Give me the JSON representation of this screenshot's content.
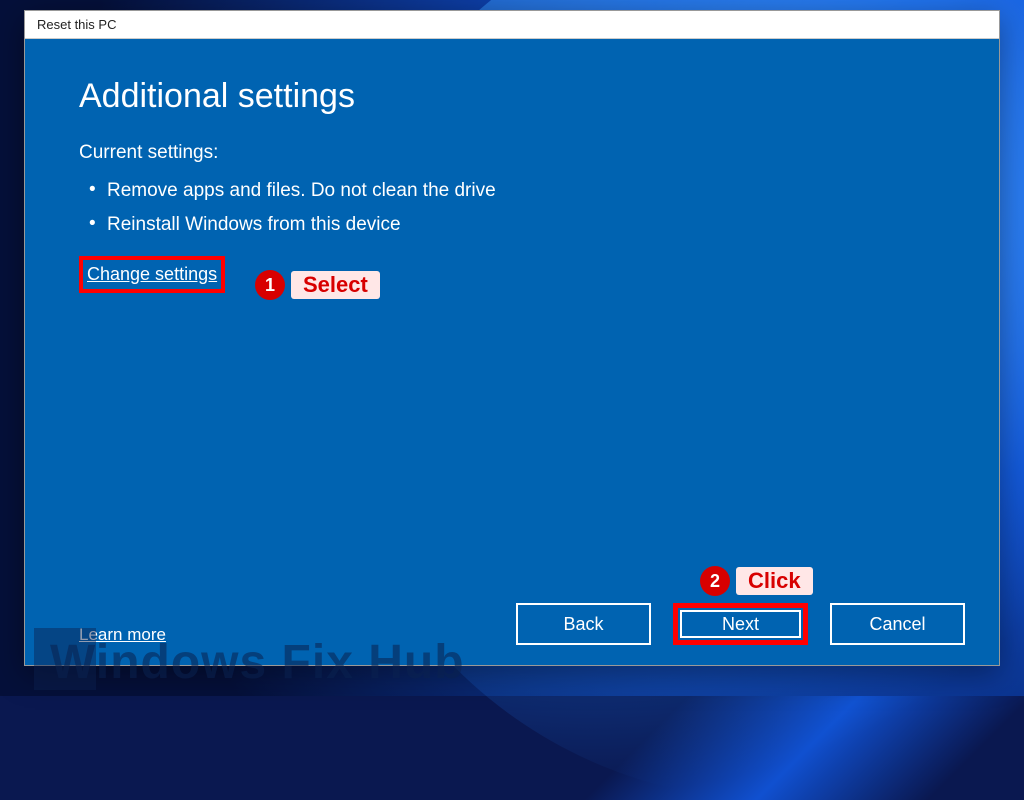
{
  "title": "Reset this PC",
  "heading": "Additional settings",
  "subhead": "Current settings:",
  "bullets": [
    "Remove apps and files. Do not clean the drive",
    "Reinstall Windows from this device"
  ],
  "change_settings": "Change settings",
  "learn_more": "Learn more",
  "buttons": {
    "back": "Back",
    "next": "Next",
    "cancel": "Cancel"
  },
  "annotations": {
    "a1": {
      "num": "1",
      "label": "Select"
    },
    "a2": {
      "num": "2",
      "label": "Click"
    }
  },
  "watermark": "Windows Fix Hub"
}
